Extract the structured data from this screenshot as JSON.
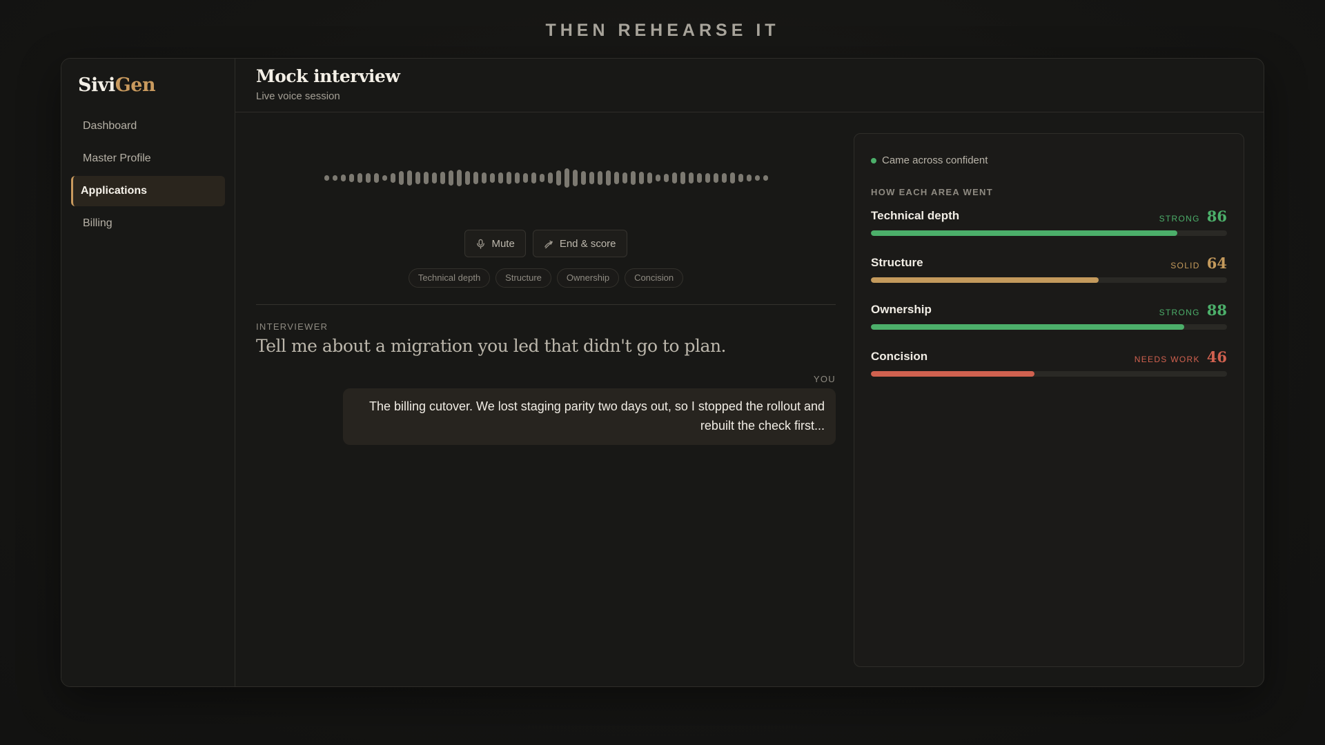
{
  "headline": "THEN REHEARSE IT",
  "brand": {
    "part1": "Sivi",
    "part2": "Gen"
  },
  "sidebar": {
    "items": [
      {
        "label": "Dashboard",
        "active": false
      },
      {
        "label": "Master Profile",
        "active": false
      },
      {
        "label": "Applications",
        "active": true
      },
      {
        "label": "Billing",
        "active": false
      }
    ]
  },
  "header": {
    "title": "Mock interview",
    "subtitle": "Live voice session"
  },
  "controls": {
    "mute_label": "Mute",
    "end_label": "End & score"
  },
  "chips": [
    "Technical depth",
    "Structure",
    "Ownership",
    "Concision"
  ],
  "transcript": {
    "interviewer_label": "INTERVIEWER",
    "question": "Tell me about a migration you led that didn't go to plan.",
    "you_label": "YOU",
    "answer": "The billing cutover. We lost staging parity two days out, so I stopped the rollout and rebuilt the check first..."
  },
  "feedback": {
    "status": "Came across confident",
    "section_label": "HOW EACH AREA WENT",
    "metrics": [
      {
        "name": "Technical depth",
        "tag": "STRONG",
        "score": 86,
        "color": "#4caf6a"
      },
      {
        "name": "Structure",
        "tag": "SOLID",
        "score": 64,
        "color": "#c49a5c"
      },
      {
        "name": "Ownership",
        "tag": "STRONG",
        "score": 88,
        "color": "#4caf6a"
      },
      {
        "name": "Concision",
        "tag": "NEEDS WORK",
        "score": 46,
        "color": "#d0614f"
      }
    ]
  },
  "colors": {
    "accent": "#c99a5e",
    "strong": "#4caf6a",
    "solid": "#c49a5c",
    "needs_work": "#d0614f"
  },
  "icons": {
    "mute": "microphone-icon",
    "end": "end-call-icon",
    "status": "status-dot-icon"
  }
}
